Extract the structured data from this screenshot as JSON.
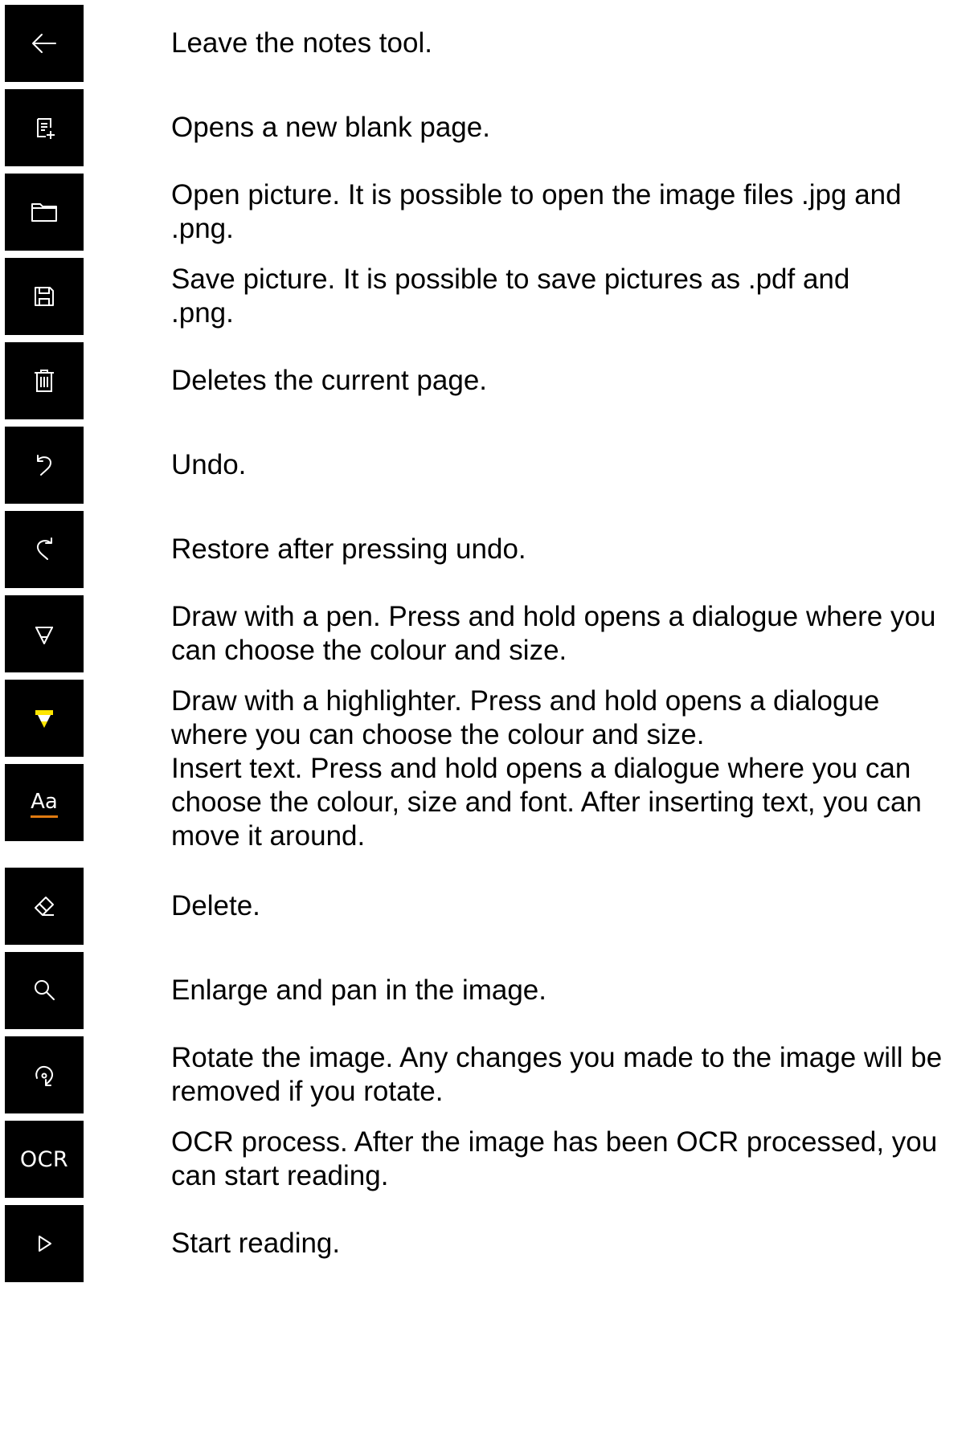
{
  "items": [
    {
      "icon": "back-arrow-icon",
      "text": "Leave the notes tool."
    },
    {
      "icon": "new-page-icon",
      "text": "Opens a new blank page."
    },
    {
      "icon": "folder-icon",
      "text": "Open picture. It is possible to open the image files .jpg and .png."
    },
    {
      "icon": "save-icon",
      "text": "Save picture. It is possible to save pictures as .pdf and .png."
    },
    {
      "icon": "trash-icon",
      "text": "Deletes the current page."
    },
    {
      "icon": "undo-icon",
      "text": "Undo."
    },
    {
      "icon": "redo-icon",
      "text": "Restore after pressing undo."
    },
    {
      "icon": "pen-icon",
      "text": "Draw with a pen. Press and hold opens a dialogue where you can choose the colour and size."
    },
    {
      "icon": "highlighter-icon",
      "text": "Draw with a highlighter. Press and hold opens a dialogue where you can choose the colour and size."
    },
    {
      "icon": "text-icon",
      "label": "Aa",
      "text": "Insert text. Press and hold opens a dialogue where you can choose the colour, size and font. After inserting text, you can move it around."
    },
    {
      "icon": "eraser-icon",
      "text": "Delete."
    },
    {
      "icon": "zoom-icon",
      "text": "Enlarge and pan in the image."
    },
    {
      "icon": "rotate-icon",
      "text": "Rotate the image. Any changes you made to the image will be removed if you rotate."
    },
    {
      "icon": "ocr-icon",
      "label": "OCR",
      "text": "OCR process. After the image has been OCR processed, you can start reading."
    },
    {
      "icon": "play-icon",
      "text": "Start reading."
    }
  ],
  "colors": {
    "tile_background": "#000000",
    "icon_foreground": "#ffffff",
    "highlighter_accent": "#ffe600",
    "text_underline_accent": "#e07a10",
    "text_color": "#000000"
  }
}
